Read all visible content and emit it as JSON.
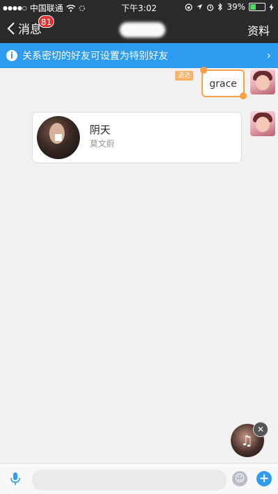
{
  "status_bar": {
    "signal": "●●●●○",
    "carrier": "中国联通",
    "time": "下午3:02",
    "battery": "39%",
    "battery_level": 0.39
  },
  "nav": {
    "back_label": "消息",
    "unread_badge": "81",
    "right_label": "资料"
  },
  "banner": {
    "text": "关系密切的好友可设置为特别好友",
    "info_glyph": "i",
    "arrow_glyph": "›"
  },
  "messages": {
    "sent_tag": "送达",
    "sticker_text": "grace",
    "music": {
      "title": "阴天",
      "artist": "莫文蔚"
    }
  },
  "floating_player": {
    "note_glyph": "♫",
    "close_glyph": "✕"
  },
  "input_bar": {
    "placeholder": "",
    "emoji_glyph": "☺",
    "plus_glyph": "+"
  },
  "colors": {
    "accent": "#2d9bf0",
    "dark_bar": "#2a2a2a",
    "badge_red": "#e62e2e",
    "sent_tag": "#f7b267"
  }
}
